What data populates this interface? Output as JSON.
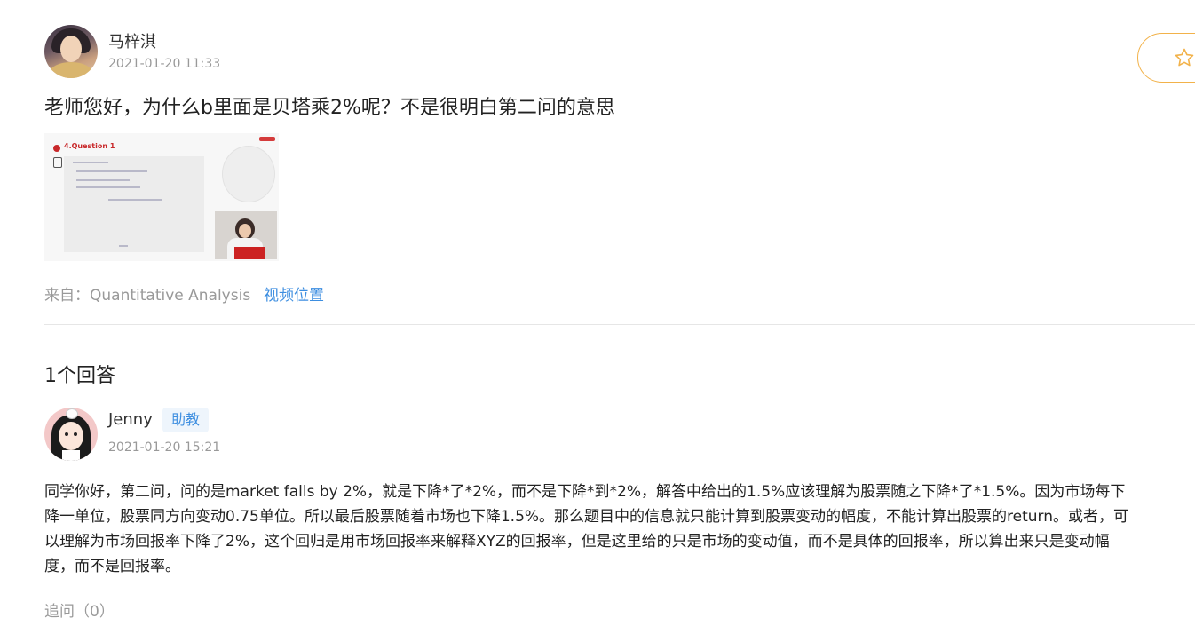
{
  "question": {
    "author": "马梓淇",
    "timestamp": "2021-01-20 11:33",
    "text": "老师您好，为什么b里面是贝塔乘2%呢？不是很明白第二问的意思",
    "attachment": {
      "slide_title": "4.Question 1",
      "icon": "slide-thumbnail"
    },
    "source_label": "来自：Quantitative Analysis",
    "source_link": "视频位置",
    "favorite_icon": "star-icon"
  },
  "answers_header": "1个回答",
  "answer": {
    "author": "Jenny",
    "role_badge": "助教",
    "timestamp": "2021-01-20 15:21",
    "text": "同学你好，第二问，问的是market falls by 2%，就是下降*了*2%，而不是下降*到*2%，解答中给出的1.5%应该理解为股票随之下降*了*1.5%。因为市场每下降一单位，股票同方向变动0.75单位。所以最后股票随着市场也下降1.5%。那么题目中的信息就只能计算到股票变动的幅度，不能计算出股票的return。或者，可以理解为市场回报率下降了2%，这个回归是用市场回报率来解释XYZ的回报率，但是这里给的只是市场的变动值，而不是具体的回报率，所以算出来只是变动幅度，而不是回报率。",
    "followup": "追问（0）"
  },
  "colors": {
    "accent": "#3d8ee0",
    "favorite": "#f2b24a",
    "muted": "#999999"
  }
}
